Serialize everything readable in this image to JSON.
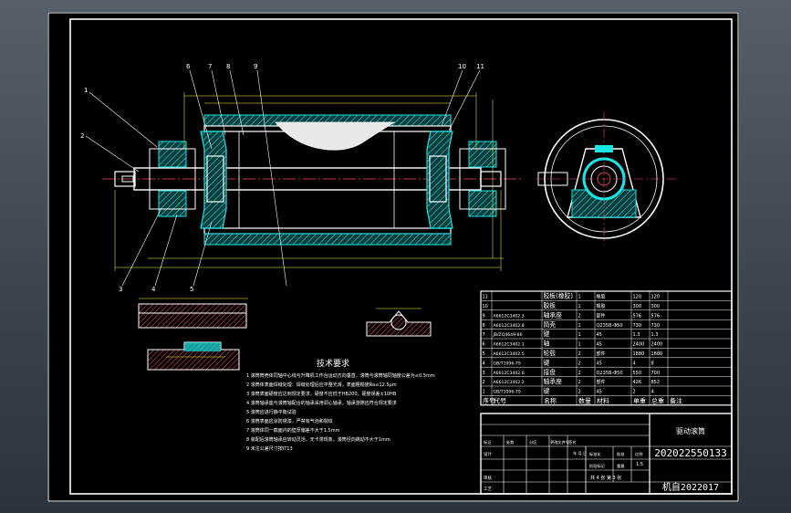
{
  "tech_requirements": {
    "title": "技术要求",
    "lines": [
      "1 滚筒筒壳体同轴中心线与升降机工作台运动方向垂直，滚筒与滚筒轴同轴度公差为≤0.5mm",
      "2 滚筒体表面焊缝处理：焊缝处理后应平整光滑，表面粗糙度Ra≤12.5μm",
      "3 滚筒表面硬度应达到规定要求，硬度不应低于HB200，硬度误差±10HB",
      "4 滚筒轴承座与滚筒轴配合的轴承采用调心轴承，轴承游隙应符合规定要求",
      "5 滚筒应进行静平衡试验",
      "6 滚筒表面应涂防锈漆，严禁有气泡和裂纹",
      "7 滚筒体同一截面内的壁厚偏差不大于1.5mm",
      "8 装配后滚筒轴承应转动灵活，无卡滞现象，滚筒径向跳动不大于1mm",
      "9 未注公差尺寸按IT13"
    ]
  },
  "bom": {
    "headers": [
      "序号",
      "代号",
      "名称",
      "数量",
      "材料",
      "单重",
      "总重",
      "备注"
    ],
    "rows": [
      [
        "11",
        "",
        "胶板(橡胶)",
        "1",
        "橡胶",
        "120",
        "120",
        ""
      ],
      [
        "10",
        "",
        "胶板",
        "1",
        "橡胶",
        "300",
        "300",
        ""
      ],
      [
        "9",
        "A6612C3402.3",
        "轴承座",
        "2",
        "部件",
        "576",
        "576",
        ""
      ],
      [
        "8",
        "A6612C3402.8",
        "筒壳",
        "1",
        "Q235B-Φ50",
        "730",
        "730",
        ""
      ],
      [
        "7",
        "JB/ZQ4649-86",
        "键",
        "1",
        "45",
        "1.3",
        "1.3",
        ""
      ],
      [
        "6",
        "A6612C3402.1",
        "轴",
        "1",
        "45",
        "2400",
        "2400",
        ""
      ],
      [
        "5",
        "A6612C3402.5",
        "轮毂",
        "2",
        "部件",
        "1880",
        "1880",
        ""
      ],
      [
        "4",
        "GB/T1096-79",
        "键",
        "2",
        "45",
        "4",
        "8",
        ""
      ],
      [
        "3",
        "A6612C3402.6",
        "接盘",
        "2",
        "Q235B-Φ50",
        "550",
        "700",
        ""
      ],
      [
        "2",
        "A6612C3402.2",
        "轴承座",
        "2",
        "部件",
        "426",
        "852",
        ""
      ],
      [
        "1",
        "GB/T1096-79",
        "键",
        "2",
        "45",
        "2",
        "4",
        ""
      ]
    ]
  },
  "title_block": {
    "drawing_name": "驱动滚筒",
    "drawing_no": "202022550133",
    "class_label": "机自2022017",
    "sheet_text": "共 4 张 第 3 张",
    "scale": "1:5",
    "row_labels": [
      "标记",
      "处数",
      "分区",
      "更改文件号",
      "签名",
      "年.月.日"
    ],
    "role_labels": [
      "设计",
      "审核",
      "工艺"
    ],
    "mid_labels": [
      "标准化",
      "批准",
      "阶段标记",
      "重量",
      "比例"
    ]
  },
  "callouts": [
    "1",
    "2",
    "3",
    "4",
    "5",
    "6",
    "7",
    "8",
    "9",
    "10",
    "11"
  ],
  "colors": {
    "frame": "#ffffff",
    "accent": "#19e6e6",
    "line": "#f0f0f0",
    "hatch": "#ff4a6e",
    "dim": "#ffff40",
    "bg": "#000000"
  }
}
